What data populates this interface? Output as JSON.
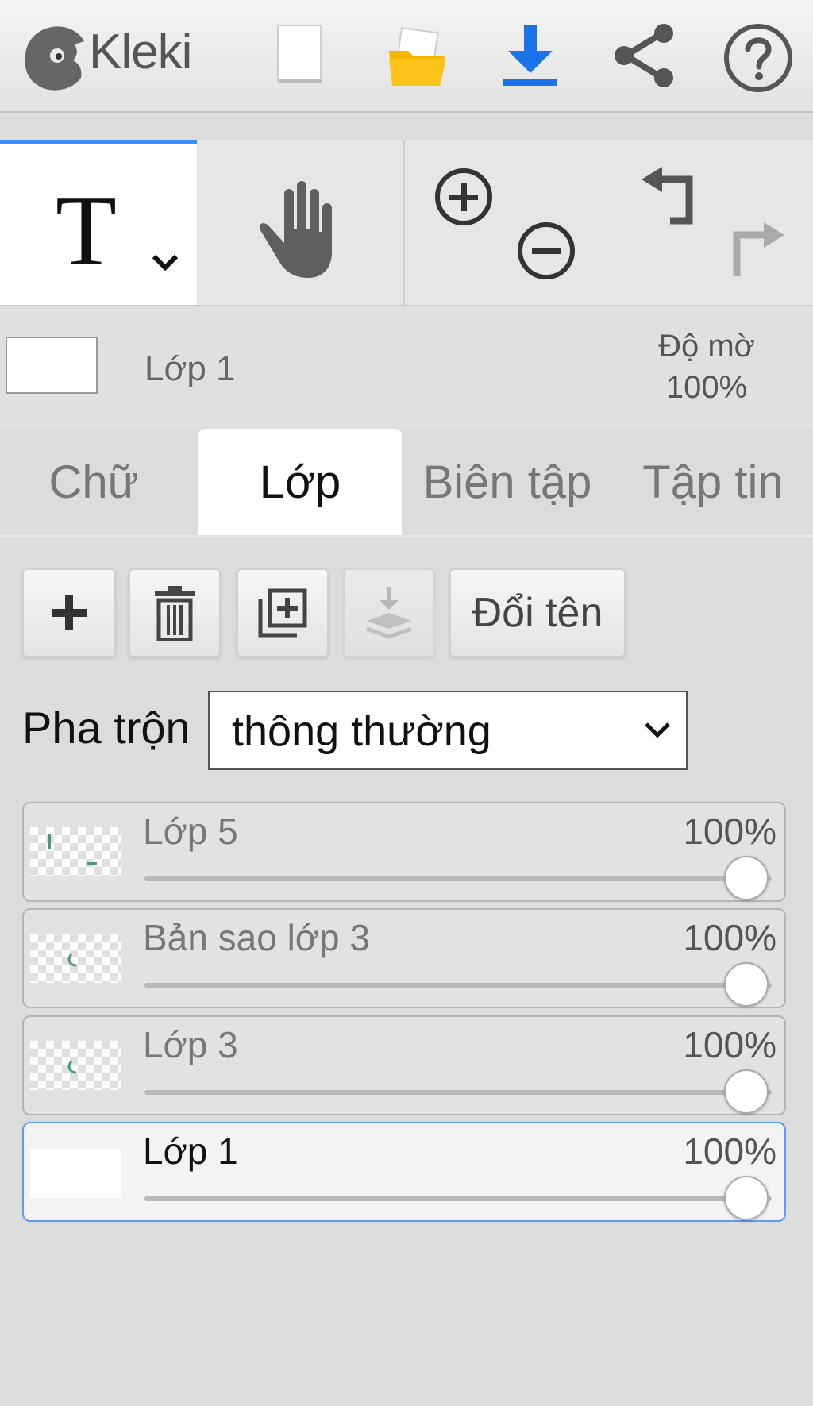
{
  "app": {
    "logo_text": "Kleki"
  },
  "colors": {
    "accent": "#3d8bfd",
    "download": "#1a73e8",
    "folder": "#f5b800"
  },
  "top_toolbar": {
    "icons": [
      "kleki-logo-icon",
      "new-file-icon",
      "open-folder-icon",
      "download-icon",
      "share-icon",
      "help-icon"
    ]
  },
  "tools": {
    "active": "text",
    "icons": [
      "text-tool-icon",
      "hand-tool-icon",
      "zoom-in-icon",
      "zoom-out-icon",
      "undo-icon",
      "redo-icon"
    ]
  },
  "layer_info": {
    "current_layer": "Lớp 1",
    "opacity_line1": "Độ mờ",
    "opacity_line2": "100%"
  },
  "tabs": [
    {
      "label": "Chữ",
      "active": false
    },
    {
      "label": "Lớp",
      "active": true
    },
    {
      "label": "Biên tập",
      "active": false
    },
    {
      "label": "Tập tin",
      "active": false
    }
  ],
  "layer_actions": {
    "rename_label": "Đổi tên"
  },
  "blend": {
    "label": "Pha trộn",
    "value": "thông thường"
  },
  "layers": [
    {
      "name": "Lớp 5",
      "opacity_label": "100%",
      "opacity": 1.0,
      "selected": false
    },
    {
      "name": "Bản sao lớp 3",
      "opacity_label": "100%",
      "opacity": 1.0,
      "selected": false
    },
    {
      "name": "Lớp 3",
      "opacity_label": "100%",
      "opacity": 1.0,
      "selected": false
    },
    {
      "name": "Lớp 1",
      "opacity_label": "100%",
      "opacity": 1.0,
      "selected": true
    }
  ]
}
